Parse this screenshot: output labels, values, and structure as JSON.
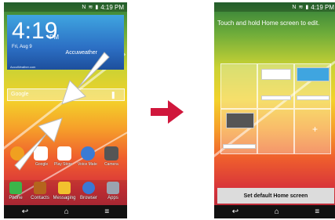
{
  "status": {
    "time": "4:19 PM"
  },
  "left_screen": {
    "clock": {
      "time": "4:19",
      "ampm": "PM",
      "date": "Fri, Aug 9",
      "weather": "Accuweather",
      "footer": "AccuWeather.com"
    },
    "search": {
      "placeholder": "Google"
    },
    "apps": [
      {
        "label": "",
        "icon": "at-icon",
        "color": "#f0a020"
      },
      {
        "label": "Google",
        "icon": "google-icon",
        "color": "#ffffff"
      },
      {
        "label": "Play Store",
        "icon": "playstore-icon",
        "color": "#ffffff"
      },
      {
        "label": "Voice Mate",
        "icon": "voicemate-icon",
        "color": "#3b7bd4"
      },
      {
        "label": "Camera",
        "icon": "camera-icon",
        "color": "#555555"
      }
    ],
    "dock": [
      {
        "label": "Phone",
        "icon": "phone-icon",
        "color": "#3bb54a"
      },
      {
        "label": "Contacts",
        "icon": "contacts-icon",
        "color": "#b5651d"
      },
      {
        "label": "Messaging",
        "icon": "messaging-icon",
        "color": "#f2c12e"
      },
      {
        "label": "Browser",
        "icon": "browser-icon",
        "color": "#3a78d4"
      },
      {
        "label": "Apps",
        "icon": "apps-grid-icon",
        "color": "#9aa3b0"
      }
    ]
  },
  "right_screen": {
    "hint": "Touch and hold Home screen to edit.",
    "set_default_label": "Set default Home screen"
  },
  "colors": {
    "arrow": "#d0173c",
    "pinch_arrow": "#ffffff"
  }
}
